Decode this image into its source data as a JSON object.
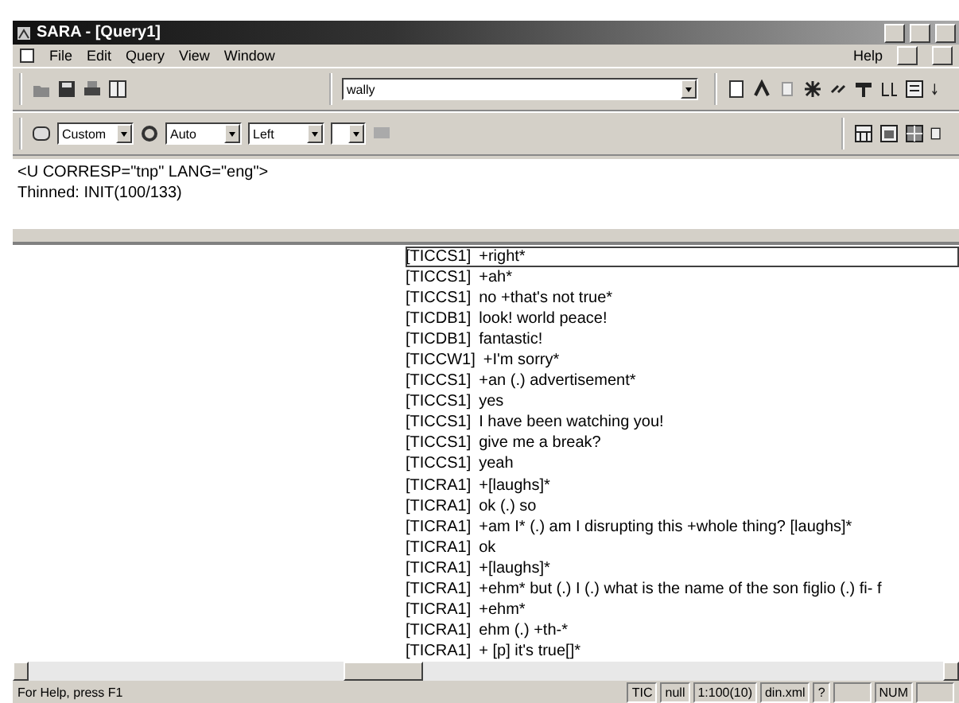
{
  "window": {
    "title": "SARA - [Query1]"
  },
  "menu": {
    "items": [
      "File",
      "Edit",
      "Query",
      "View",
      "Window"
    ],
    "help": "Help"
  },
  "toolbar": {
    "search": {
      "value": "wally"
    }
  },
  "format_bar": {
    "combos": [
      {
        "value": "Custom"
      },
      {
        "value": "Auto"
      },
      {
        "value": "Left"
      },
      {
        "kind": "blank"
      }
    ]
  },
  "header": {
    "lines": [
      "<U CORRESP=\"tnp\" LANG=\"eng\">",
      "Thinned: INIT(100/133)"
    ]
  },
  "results": [
    {
      "speaker": "[TICCS1]",
      "text": "+right*",
      "selected": true
    },
    {
      "speaker": "[TICCS1]",
      "text": "+ah*",
      "selected": false
    },
    {
      "speaker": "[TICCS1]",
      "text": "no +that's not true*",
      "selected": false
    },
    {
      "speaker": "[TICDB1]",
      "text": "look! world peace!",
      "selected": false
    },
    {
      "speaker": "[TICDB1]",
      "text": "fantastic!",
      "selected": false
    },
    {
      "speaker": "[TICCW1]",
      "text": "+I'm sorry*",
      "selected": false
    },
    {
      "speaker": "[TICCS1]",
      "text": "+an (.) advertisement*",
      "selected": false
    },
    {
      "speaker": "[TICCS1]",
      "text": "yes",
      "selected": false
    },
    {
      "speaker": "[TICCS1]",
      "text": "I have been watching you!",
      "selected": false
    },
    {
      "speaker": "[TICCS1]",
      "text": "give me a break?",
      "selected": false
    },
    {
      "speaker": "[TICCS1]",
      "text": "yeah",
      "selected": false
    },
    {
      "speaker": "[TICRA1]",
      "text": "+[laughs]*",
      "selected": false
    },
    {
      "speaker": "[TICRA1]",
      "text": "ok (.) so",
      "selected": false
    },
    {
      "speaker": "[TICRA1]",
      "text": "+am I* (.) am I disrupting this +whole thing? [laughs]*",
      "selected": false
    },
    {
      "speaker": "[TICRA1]",
      "text": "ok",
      "selected": false
    },
    {
      "speaker": "[TICRA1]",
      "text": "+[laughs]*",
      "selected": false
    },
    {
      "speaker": "[TICRA1]",
      "text": "+ehm* but (.) I (.) what is the name of the son figlio (.) fi- f",
      "selected": false
    },
    {
      "speaker": "[TICRA1]",
      "text": "+ehm*",
      "selected": false
    },
    {
      "speaker": "[TICRA1]",
      "text": "ehm (.) +th-*",
      "selected": false
    },
    {
      "speaker": "[TICRA1]",
      "text": "+ [p] it's true[]*",
      "selected": false
    }
  ],
  "status_bar": {
    "message": "For Help, press F1",
    "panes": [
      {
        "kind": "text",
        "text": "TIC"
      },
      {
        "kind": "text",
        "text": "null"
      },
      {
        "kind": "text",
        "text": "1:100(10)"
      },
      {
        "kind": "text",
        "text": "din.xml"
      },
      {
        "kind": "text",
        "text": "?"
      },
      {
        "kind": "blank"
      },
      {
        "kind": "text",
        "text": "NUM"
      },
      {
        "kind": "blank"
      }
    ]
  }
}
